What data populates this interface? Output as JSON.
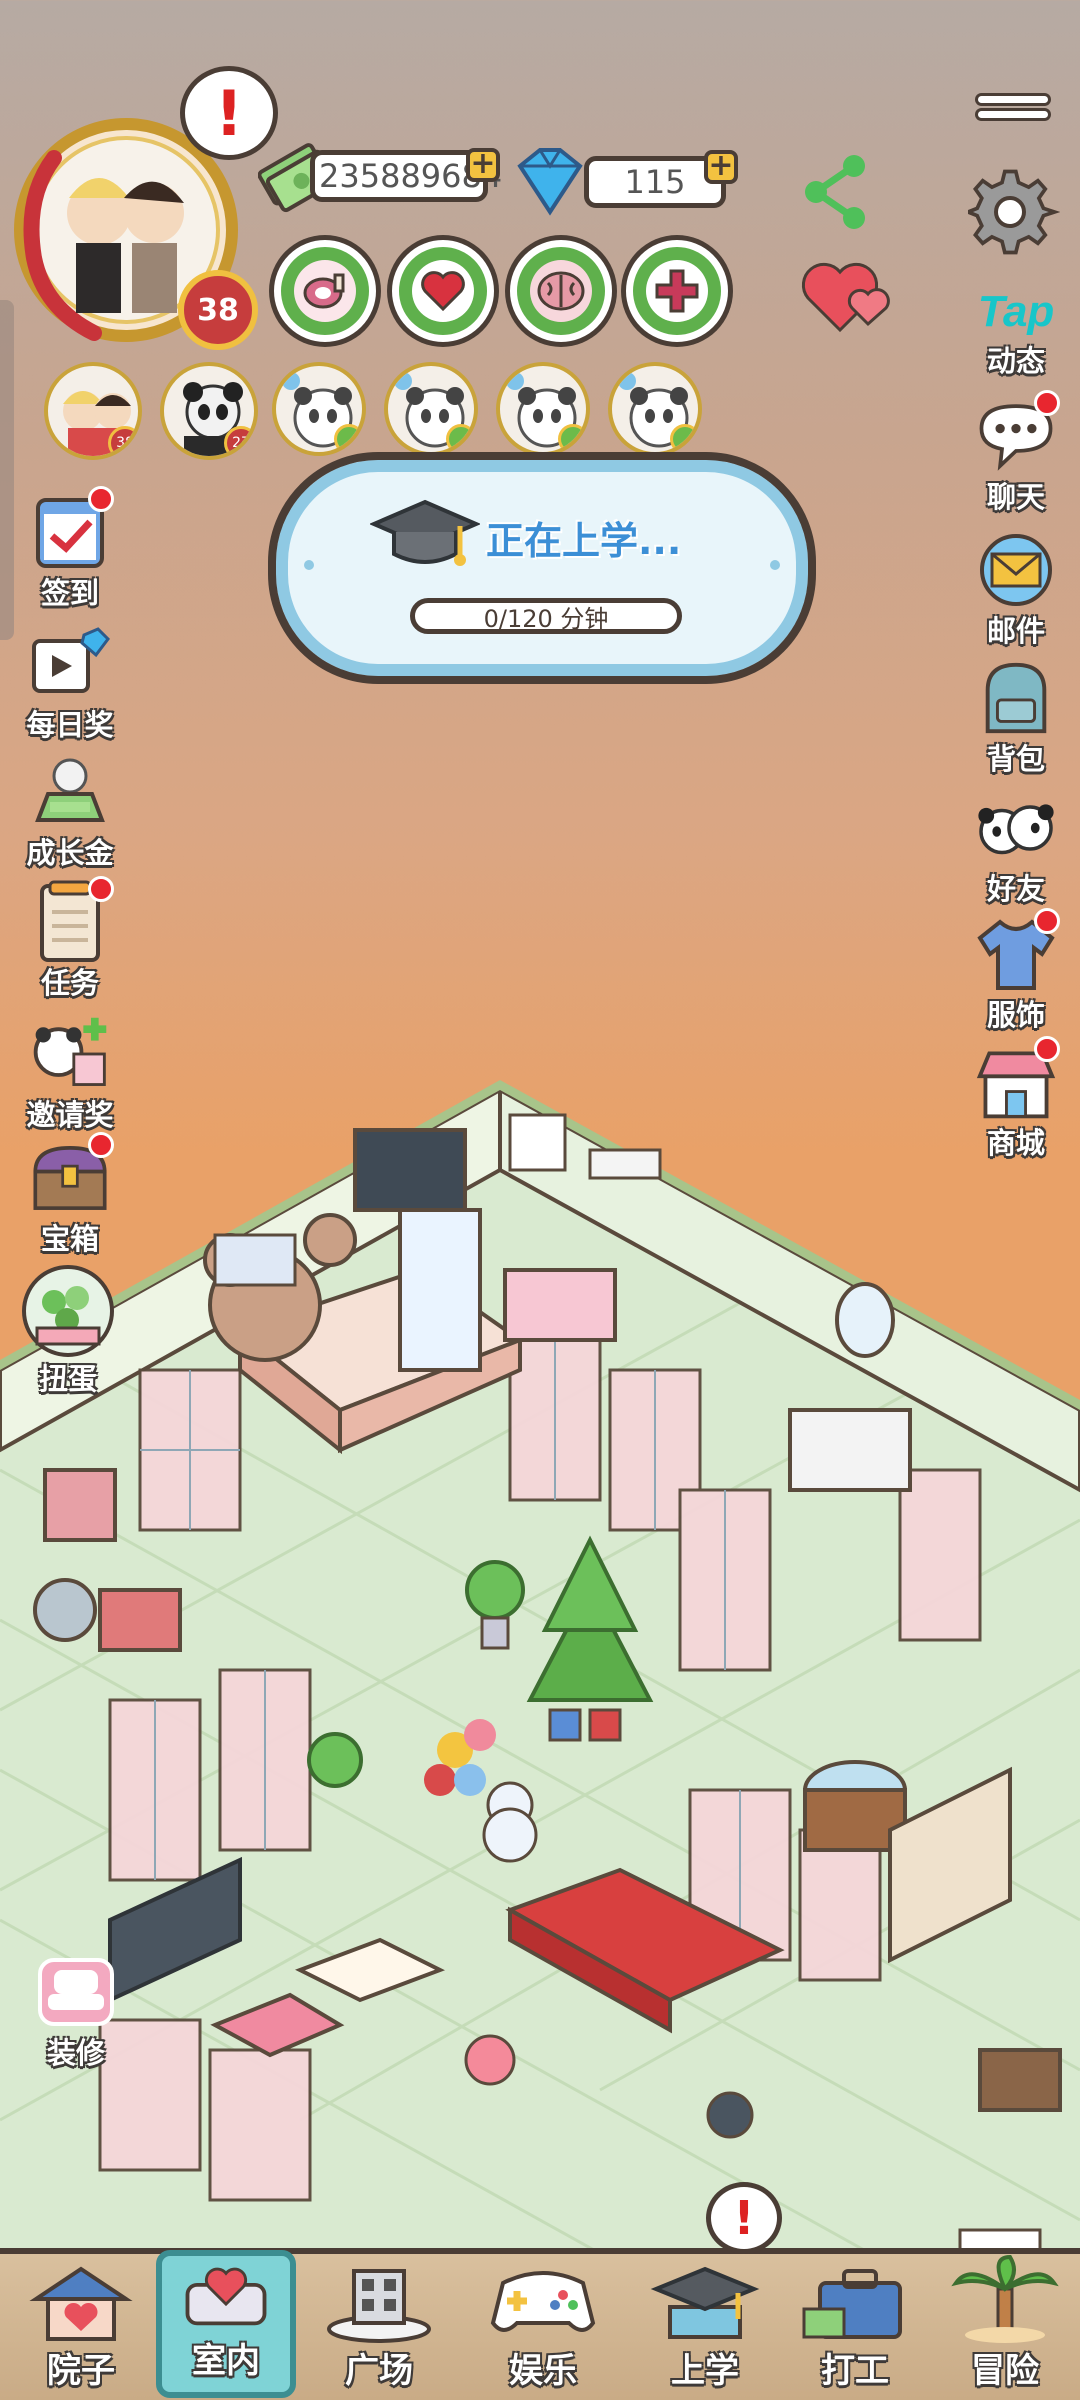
{
  "player": {
    "level": "38",
    "alert": "!"
  },
  "currency": {
    "coins": "235889684",
    "gems": "115",
    "plus": "+"
  },
  "stats": [
    {
      "icon": "meat-icon",
      "color": "#d86b8a"
    },
    {
      "icon": "heart-icon",
      "color": "#d8323f"
    },
    {
      "icon": "brain-icon",
      "color": "#e69aa6"
    },
    {
      "icon": "health-plus-icon",
      "color": "#c83a5a"
    }
  ],
  "party": [
    {
      "level": "38"
    },
    {
      "level": "27"
    }
  ],
  "pets": [
    {},
    {},
    {},
    {}
  ],
  "school_card": {
    "title": "正在上学...",
    "progress": "0/120 分钟",
    "progress_value": 0
  },
  "left_menu": [
    {
      "label": "签到",
      "dot": true
    },
    {
      "label": "每日奖",
      "dot": false
    },
    {
      "label": "成长金",
      "dot": false
    },
    {
      "label": "任务",
      "dot": true
    },
    {
      "label": "邀请奖",
      "dot": false
    },
    {
      "label": "宝箱",
      "dot": true
    },
    {
      "label": "扭蛋",
      "dot": false
    },
    {
      "label": "装修",
      "dot": false
    }
  ],
  "right_menu": [
    {
      "label": "动态",
      "brand": "Tap"
    },
    {
      "label": "聊天",
      "dot": true
    },
    {
      "label": "邮件"
    },
    {
      "label": "背包"
    },
    {
      "label": "好友"
    },
    {
      "label": "服饰",
      "dot": true
    },
    {
      "label": "商城",
      "dot": true
    }
  ],
  "bottom_nav": [
    {
      "label": "院子"
    },
    {
      "label": "室内",
      "active": true
    },
    {
      "label": "广场"
    },
    {
      "label": "娱乐"
    },
    {
      "label": "上学",
      "alert": "!"
    },
    {
      "label": "打工"
    },
    {
      "label": "冒险"
    }
  ],
  "colors": {
    "accent_blue": "#3c8fd6",
    "outline": "#4a3d35",
    "green": "#5fb04c",
    "red_dot": "#e8262f"
  }
}
